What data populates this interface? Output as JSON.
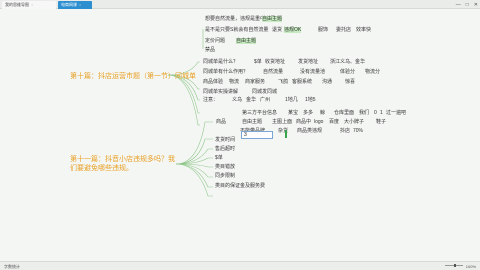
{
  "tabs": [
    {
      "label": "我的思维导图",
      "close": "×"
    },
    {
      "label": "电商网课",
      "close": "×"
    }
  ],
  "window": {
    "minimize": "—",
    "maximize": "□",
    "close": "✕"
  },
  "statusbar": {
    "left": "字数统计",
    "zoom": "100%"
  },
  "nodes": {
    "t1": "想要自然流量，违规是重中之重",
    "t1b": "自由主题",
    "t2": "是不是只要S就会有自然流量",
    "t2b": "退货",
    "t2c": "违规OK",
    "t2d": "服饰",
    "t2e": "委托店",
    "t2f": "效率快",
    "t3": "定价问题",
    "t3b": "自由主题",
    "t4": "禁品",
    "main1": "第十篇：抖店运营市题（第一节）同城单",
    "main2": "第十一篇：抖音小店违规多吗？我们要避免哪些违规。",
    "a1": "同城单是什么？",
    "a1b": "$单",
    "a1c": "收货地址",
    "a1d": "发货地址",
    "a1e": "浙江义乌、金华",
    "a2": "同城单有什么作用？",
    "a2b": "自然流量",
    "a2c": "没有流量池",
    "a2d": "体验分",
    "a2e": "物流分",
    "a3": "商品体验",
    "a3b": "物流",
    "a3c": "商家服务",
    "a3d": "飞鸽",
    "a3e": "客服系统",
    "a3f": "沟通",
    "a3g": "惊喜",
    "a4": "同城单实操讲解",
    "a4b": "同城发同城",
    "a5": "注意：",
    "a5b": "义乌",
    "a5c": "金华",
    "a5d": "广州",
    "a5e": "1地几",
    "a5f": "1地5",
    "b0": "第三方平台信息",
    "b0b": "某宝",
    "b0c": "多多",
    "b0d": "鲸",
    "b0e": "仓库里面",
    "b0f": "我们",
    "b0g": "0",
    "b0h": "1",
    "b0i": "过一遍吧",
    "b1": "商品",
    "b1b": "自由主题",
    "b1c": "主图上面",
    "b1d": "商品中",
    "b1e": "logo",
    "b1f": "百度",
    "b1g": "大小牌子",
    "b1h": "鞋子",
    "b2": "不能带品牌",
    "b2b": "杂货",
    "b2c": "商品类违规",
    "b2d": "抖店",
    "b2e": "70%",
    "c1": "发货时间",
    "c1input": "3",
    "c2": "售后超时",
    "c3": "$单",
    "c4": "类目错放",
    "c5": "同步限制",
    "c6": "类目的保证金及服务费"
  },
  "colors": {
    "branch": "#e8a023",
    "highlight": "#c6ebc0",
    "line": "#8fc78a"
  }
}
